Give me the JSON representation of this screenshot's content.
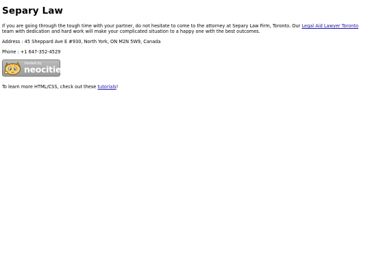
{
  "page": {
    "title": "Separy Law",
    "intro_before_link": "If you are going through the tough time with your partner, do not hesitate to come to the attorney at Separy Law Firm, Toronto. Our ",
    "intro_link": "Legal Aid Lawyer Toronto",
    "intro_after_link": " team with dedication and hard work will make your complicated situation to a happy one with the best outcomes.",
    "address": "Address : 45 Sheppard Ave E #930, North York, ON M2N 5W9, Canada",
    "phone": "Phone : +1 647-352-4529",
    "footer_before_link": "To learn more HTML/CSS, check out these ",
    "footer_link": "tutorials",
    "footer_after_link": "!"
  },
  "badge": {
    "hosted_by": "hosted by",
    "brand": "neocities",
    "icon": "neocities-cat-icon"
  }
}
